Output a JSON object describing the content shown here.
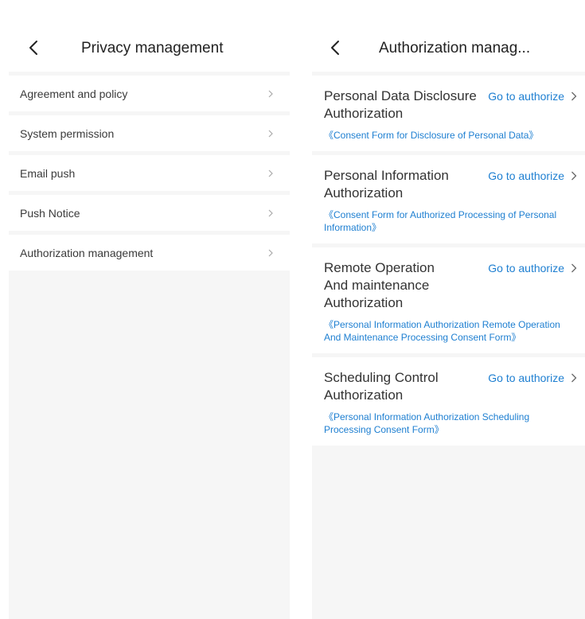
{
  "left": {
    "title": "Privacy management",
    "items": [
      {
        "label": "Agreement and policy"
      },
      {
        "label": "System permission"
      },
      {
        "label": "Email push"
      },
      {
        "label": "Push Notice"
      },
      {
        "label": "Authorization management"
      }
    ]
  },
  "right": {
    "title": "Authorization manag...",
    "cards": [
      {
        "title_lines": [
          "Personal Data Disclosure",
          "Authorization"
        ],
        "action": "Go to authorize",
        "link": "《Consent Form for Disclosure of Personal Data》"
      },
      {
        "title_lines": [
          "Personal Information",
          "Authorization"
        ],
        "action": "Go to authorize",
        "link": "《Consent Form for Authorized Processing of Personal Information》"
      },
      {
        "title_lines": [
          "Remote Operation",
          "And maintenance",
          "Authorization"
        ],
        "action": "Go to authorize",
        "link": "《Personal Information Authorization Remote Operation And Maintenance Processing Consent Form》"
      },
      {
        "title_lines": [
          "Scheduling Control",
          "Authorization"
        ],
        "action": "Go to authorize",
        "link": "《Personal Information Authorization Scheduling Processing Consent Form》"
      }
    ]
  },
  "colors": {
    "accent": "#1e7fd1",
    "background": "#f6f6f6",
    "text": "#333333"
  },
  "icons": {
    "back": "chevron-left-icon",
    "row": "chevron-right-icon"
  }
}
